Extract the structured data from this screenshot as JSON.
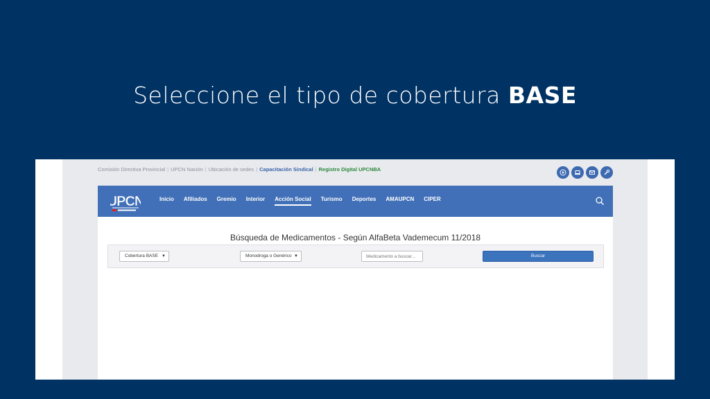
{
  "slide": {
    "title_prefix": "Seleccione el tipo de cobertura ",
    "title_bold": "BASE"
  },
  "topbar": {
    "links": [
      "Comisión Directiva Provincial",
      "UPCN Nación",
      "Ubicación de sedes"
    ],
    "separator": "|",
    "capacitacion": "Capacitación Sindical",
    "registro": "Registro Digital UPCNBA",
    "icons": [
      "play-icon",
      "laptop-icon",
      "mail-icon",
      "wrench-icon"
    ]
  },
  "navbar": {
    "logo_text": "UPCN",
    "items": [
      "Inicio",
      "Afiliados",
      "Gremio",
      "Interior",
      "Acción Social",
      "Turismo",
      "Deportes",
      "AMAUPCN",
      "CIPER"
    ],
    "active_item": "Acción Social"
  },
  "search": {
    "title": "Búsqueda de Medicamentos - Según AlfaBeta Vademecum 11/2018",
    "cobertura_value": "Cobertura BASE",
    "tipo_value": "Monodroga o Genérico",
    "medicamento_placeholder": "Medicamento a buscar...",
    "button_label": "Buscar"
  },
  "colors": {
    "background": "#003263",
    "navbar": "#4170b8",
    "button": "#3b73bd",
    "registro": "#2c8a3d"
  }
}
